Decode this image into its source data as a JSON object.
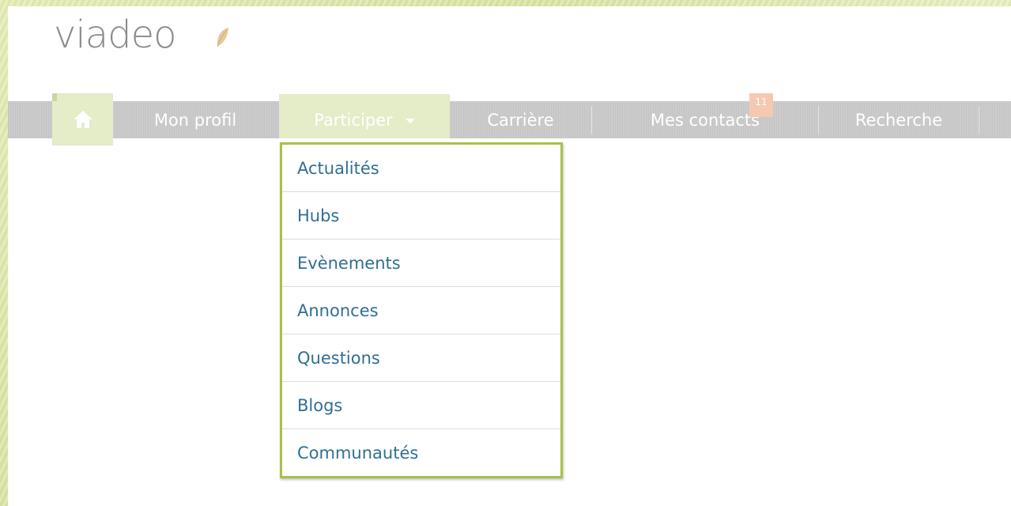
{
  "brand": {
    "logo_text": "viadeo"
  },
  "nav": {
    "home_icon": "home-icon",
    "items": [
      {
        "label": "Mon profil"
      },
      {
        "label": "Participer",
        "active": true
      },
      {
        "label": "Carrière"
      },
      {
        "label": "Mes contacts",
        "badge": "11"
      },
      {
        "label": "Recherche"
      }
    ]
  },
  "dropdown": {
    "items": [
      {
        "label": "Actualités"
      },
      {
        "label": "Hubs"
      },
      {
        "label": "Evènements"
      },
      {
        "label": "Annonces"
      },
      {
        "label": "Questions"
      },
      {
        "label": "Blogs"
      },
      {
        "label": "Communautés"
      }
    ]
  },
  "colors": {
    "accent_green": "#a6c247",
    "active_tab_bg": "#e4ecc8",
    "nav_bg": "#c8c8c8",
    "link_blue": "#2f6f92",
    "badge_bg": "#f5c9b0"
  }
}
